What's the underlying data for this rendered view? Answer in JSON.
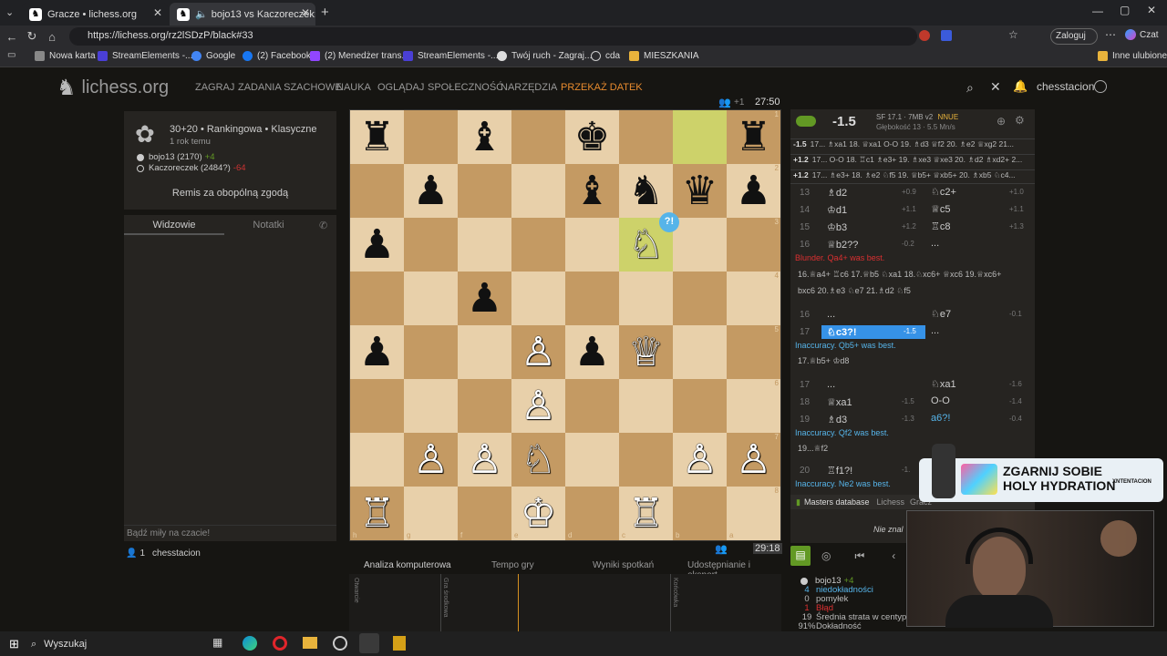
{
  "browser": {
    "tabs": [
      {
        "label": "Gracze • lichess.org"
      },
      {
        "label": "bojo13 vs Kaczoreczek: Caro-"
      }
    ],
    "url": "https://lichess.org/rz2lSDzP/black#33",
    "zaloguj": "Zaloguj",
    "czat": "Czat",
    "bookmarks": [
      "Nowa karta",
      "StreamElements -...",
      "Google",
      "(2) Facebook",
      "(2) Menedżer trans...",
      "StreamElements -...",
      "Twój ruch - Zagraj...",
      "cda",
      "MIESZKANIA"
    ],
    "inne": "Inne ulubione"
  },
  "site": {
    "logo": "lichess.org",
    "nav": [
      "ZAGRAJ",
      "ZADANIA SZACHOWE",
      "NAUKA",
      "OGLĄDAJ",
      "SPOŁECZNOŚĆ",
      "NARZĘDZIA",
      "PRZEKAŻ DATEK"
    ],
    "user": "chesstacion"
  },
  "game": {
    "info": "30+20 • Rankingowa • Klasyczne",
    "time_ago": "1 rok temu",
    "white_player": "bojo13 (2170)",
    "white_diff": "+4",
    "black_player": "Kaczoreczek (2484?)",
    "black_diff": "-64",
    "result": "Remis za obopólną zgodą",
    "clock_top": "27:50",
    "clock_bottom": "29:18",
    "spectators": "+1"
  },
  "chat": {
    "tab_spectators": "Widzowie",
    "tab_notes": "Notatki",
    "placeholder": "Bądź miły na czacie!",
    "viewers_count": "1",
    "viewer": "chesstacion"
  },
  "board": {
    "ranks": [
      [
        "♜",
        "",
        "♝",
        "",
        "♚",
        "",
        "",
        "♜"
      ],
      [
        "",
        "♟",
        "",
        "",
        "♝",
        "♞",
        "♛",
        "♟"
      ],
      [
        "♟",
        "",
        "",
        "",
        "",
        "♘",
        "",
        ""
      ],
      [
        "",
        "",
        "♟",
        "",
        "",
        "",
        "",
        ""
      ],
      [
        "♟",
        "",
        "",
        "♙",
        "♟",
        "♕",
        "",
        ""
      ],
      [
        "",
        "",
        "",
        "♙",
        "",
        "",
        "",
        ""
      ],
      [
        "",
        "♙",
        "♙",
        "♘",
        "",
        "",
        "♙",
        "♙"
      ],
      [
        "♖",
        "",
        "",
        "♔",
        "",
        "♖",
        "",
        ""
      ]
    ],
    "files": [
      "h",
      "g",
      "f",
      "e",
      "d",
      "c",
      "b",
      "a"
    ],
    "annotation": "?!"
  },
  "engine": {
    "eval": "-1.5",
    "name": "SF 17.1 · 7MB v2",
    "nnue": "NNUE",
    "depth": "Głębokość 13 · 5.5 Mn/s",
    "lines": [
      {
        "eval": "-1.5",
        "moves": "17... ♗xa1 18. ♕xa1 O-O 19. ♗d3 ♕f2 20. ♗e2 ♕xg2 21..."
      },
      {
        "eval": "+1.2",
        "moves": "17... O-O 18. ♖c1 ♗e3+ 19. ♗xe3 ♕xe3 20. ♗d2 ♗xd2+ 2..."
      },
      {
        "eval": "+1.2",
        "moves": "17... ♗e3+ 18. ♗e2 ♘f5 19. ♕b5+ ♕xb5+ 20. ♗xb5 ♘c4..."
      }
    ]
  },
  "moves": {
    "rows": [
      {
        "n": "13",
        "w": "♗d2",
        "we": "+0.9",
        "b": "♘c2+",
        "be": "+1.0"
      },
      {
        "n": "14",
        "w": "♔d1",
        "we": "+1.1",
        "b": "♕c5",
        "be": "+1.1"
      },
      {
        "n": "15",
        "w": "♔b3",
        "we": "+1.2",
        "b": "♖c8",
        "be": "+1.3"
      },
      {
        "n": "16",
        "w": "♕b2??",
        "we": "-0.2",
        "b": "...",
        "be": ""
      }
    ],
    "blunder": "Blunder. Qa4+ was best.",
    "blunder_line": "16.♕a4+ ♖c6 17.♕b5 ♘xa1 18.♘xc6+ ♕xc6 19.♕xc6+",
    "blunder_line2": "bxc6 20.♗e3 ♘e7 21.♗d2 ♘f5",
    "row16b": {
      "n": "16",
      "w": "...",
      "b": "♘e7",
      "be": "-0.1"
    },
    "row17": {
      "n": "17",
      "w": "♘c3?!",
      "we": "-1.5",
      "b": "..."
    },
    "inacc1": "Inaccuracy. Qb5+ was best.",
    "inacc1_line": "17.♕b5+ ♔d8",
    "rows2": [
      {
        "n": "17",
        "w": "...",
        "we": "",
        "b": "♘xa1",
        "be": "-1.6"
      },
      {
        "n": "18",
        "w": "♕xa1",
        "we": "-1.5",
        "b": "O-O",
        "be": "-1.4"
      },
      {
        "n": "19",
        "w": "♗d3",
        "we": "-1.3",
        "b": "a6?!",
        "be": "-0.4"
      }
    ],
    "inacc2": "Inaccuracy. Qf2 was best.",
    "inacc2_line": "19...♕f2",
    "row20": {
      "n": "20",
      "w": "♖f1?!",
      "we": "-1."
    },
    "inacc3": "Inaccuracy. Ne2 was best."
  },
  "masters": {
    "label": "Masters database",
    "tabs": [
      "Lichess",
      "Gracz"
    ],
    "nie": "Nie znal"
  },
  "bottom_tabs": [
    "Analiza komputerowa",
    "Tempo gry",
    "Wyniki rozgrywki",
    "Udostępnianie i eksport"
  ],
  "bottom_tabs_alt": [
    "Wyniki spotkań"
  ],
  "chart_axis": [
    "Otwarcie",
    "Gra środkowa",
    "Końcówka"
  ],
  "summary": {
    "player": "bojo13",
    "diff": "+4",
    "stats": [
      {
        "v": "4",
        "l": "niedokładności",
        "c": "#56b4e9"
      },
      {
        "v": "0",
        "l": "pomyłek",
        "c": "#bababa"
      },
      {
        "v": "1",
        "l": "Błąd",
        "c": "#db3031"
      },
      {
        "v": "19",
        "l": "Średnia strata w centypio",
        "c": "#bababa"
      },
      {
        "v": "91%",
        "l": "Dokładność",
        "c": "#bababa"
      }
    ]
  },
  "ad": {
    "line1": "ZGARNIJ SOBIE",
    "line2": "HOLY HYDRATION",
    "code": "XNTENTACION"
  },
  "taskbar": {
    "search": "Wyszukaj"
  }
}
